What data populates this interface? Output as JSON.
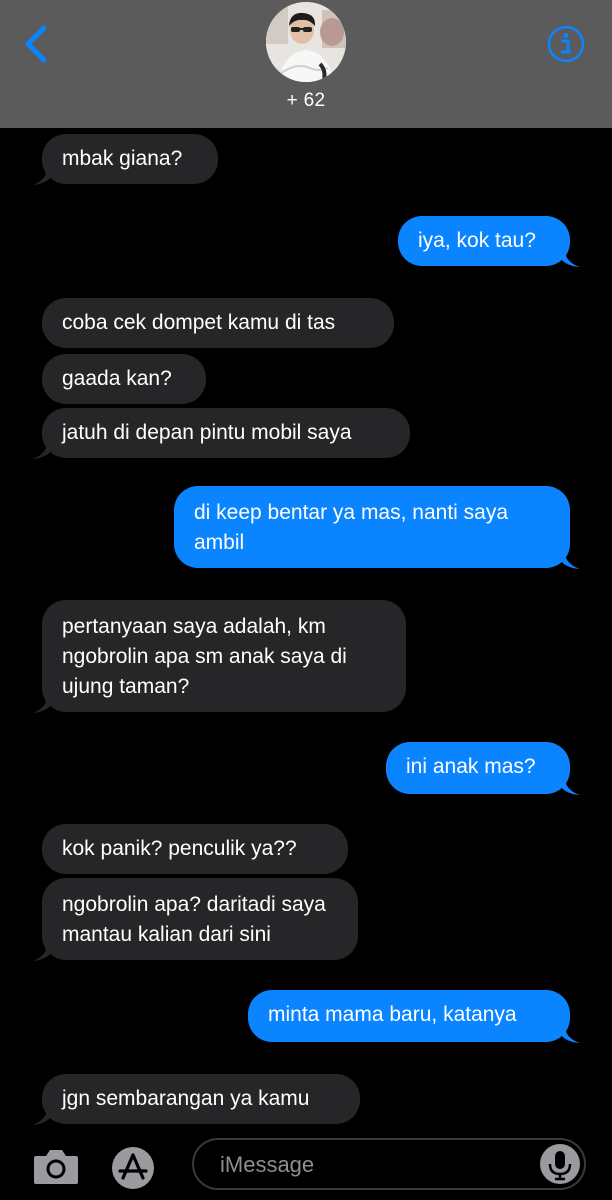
{
  "header": {
    "contact": "+ 62",
    "back_icon": "chevron-left-icon",
    "info_icon": "info-circle-icon",
    "accent_color": "#0b84ff"
  },
  "messages": [
    {
      "from": "them",
      "text": "mbak giana?"
    },
    {
      "from": "me",
      "text": "iya, kok tau?"
    },
    {
      "from": "them",
      "text": "coba cek dompet kamu di tas"
    },
    {
      "from": "them",
      "text": "gaada kan?"
    },
    {
      "from": "them",
      "text": "jatuh di depan pintu mobil saya"
    },
    {
      "from": "me",
      "lines": [
        "di keep bentar ya mas, nanti saya",
        "ambil"
      ]
    },
    {
      "from": "them",
      "lines": [
        "pertanyaan saya adalah, km",
        "ngobrolin apa sm anak saya di",
        "ujung taman?"
      ]
    },
    {
      "from": "me",
      "text": "ini anak mas?"
    },
    {
      "from": "them",
      "text": "kok panik? penculik ya??"
    },
    {
      "from": "them",
      "lines": [
        "ngobrolin apa? daritadi saya",
        "mantau kalian dari sini"
      ]
    },
    {
      "from": "me",
      "text": "minta mama baru, katanya"
    },
    {
      "from": "them",
      "text": "jgn sembarangan ya kamu"
    }
  ],
  "composer": {
    "placeholder": "iMessage",
    "camera_icon": "camera-icon",
    "apps_icon": "app-store-icon",
    "mic_icon": "microphone-icon"
  },
  "colors": {
    "incoming_bubble": "#262628",
    "outgoing_bubble": "#0b84ff",
    "header_bg": "#5b5b5b"
  }
}
